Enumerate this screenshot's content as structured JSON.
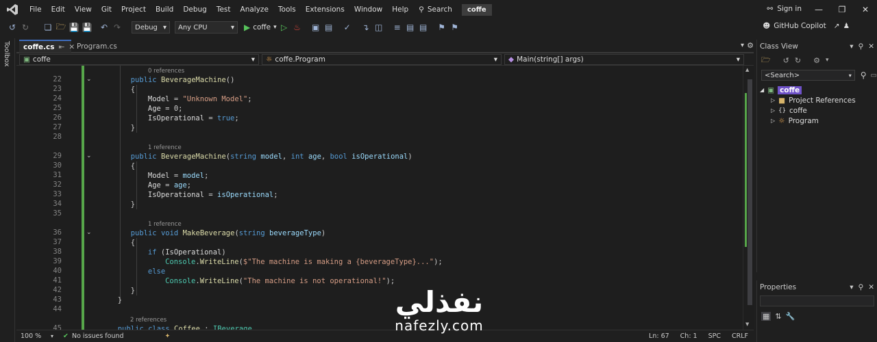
{
  "menu": [
    "File",
    "Edit",
    "View",
    "Git",
    "Project",
    "Build",
    "Debug",
    "Test",
    "Analyze",
    "Tools",
    "Extensions",
    "Window",
    "Help"
  ],
  "search_label": "Search",
  "solution_name": "coffe",
  "sign_in": "Sign in",
  "toolbar": {
    "config": "Debug",
    "platform": "Any CPU",
    "run_target": "coffe"
  },
  "copilot": "GitHub Copilot",
  "toolbox_label": "Toolbox",
  "tabs": [
    {
      "label": "coffe.cs"
    },
    {
      "label": "Program.cs"
    }
  ],
  "nav": {
    "project": "coffe",
    "type": "coffe.Program",
    "member": "Main(string[] args)"
  },
  "code_lines": [
    {
      "num": "",
      "ref": "0 references"
    },
    {
      "num": "22",
      "fold": true,
      "text": "public BeverageMachine()"
    },
    {
      "num": "23",
      "text": "{"
    },
    {
      "num": "24",
      "text": "Model = \"Unknown Model\";"
    },
    {
      "num": "25",
      "text": "Age = 0;"
    },
    {
      "num": "26",
      "text": "IsOperational = true;"
    },
    {
      "num": "27",
      "text": "}"
    },
    {
      "num": "28",
      "text": ""
    },
    {
      "num": "",
      "ref": "1 reference"
    },
    {
      "num": "29",
      "fold": true,
      "text": "public BeverageMachine(string model, int age, bool isOperational)"
    },
    {
      "num": "30",
      "text": "{"
    },
    {
      "num": "31",
      "text": "Model = model;"
    },
    {
      "num": "32",
      "text": "Age = age;"
    },
    {
      "num": "33",
      "text": "IsOperational = isOperational;"
    },
    {
      "num": "34",
      "text": "}"
    },
    {
      "num": "35",
      "text": ""
    },
    {
      "num": "",
      "ref": "1 reference"
    },
    {
      "num": "36",
      "fold": true,
      "text": "public void MakeBeverage(string beverageType)"
    },
    {
      "num": "37",
      "text": "{"
    },
    {
      "num": "38",
      "text": "if (IsOperational)"
    },
    {
      "num": "39",
      "text": "Console.WriteLine($\"The machine is making a {beverageType}...\");"
    },
    {
      "num": "40",
      "text": "else"
    },
    {
      "num": "41",
      "text": "Console.WriteLine(\"The machine is not operational!\");"
    },
    {
      "num": "42",
      "text": "}"
    },
    {
      "num": "43",
      "text": "}"
    },
    {
      "num": "44",
      "text": ""
    },
    {
      "num": "",
      "ref": "2 references"
    },
    {
      "num": "45",
      "text": "public class Coffee : IBeverage"
    }
  ],
  "status": {
    "zoom": "100 %",
    "issues": "No issues found",
    "ln": "Ln: 67",
    "ch": "Ch: 1",
    "enc": "SPC",
    "eol": "CRLF"
  },
  "classview": {
    "title": "Class View",
    "search_placeholder": "<Search>",
    "root": "coffe",
    "items": [
      "Project References",
      "coffe",
      "Program"
    ]
  },
  "properties_title": "Properties",
  "watermark": {
    "arabic": "نفذلي",
    "latin": "nafezly.com"
  },
  "colors": {
    "accent": "#3f6ebf",
    "green_bar": "#57a64a",
    "keyword": "#569cd6",
    "type": "#4ec9b0",
    "method": "#dcdcaa",
    "string": "#d69d85"
  }
}
